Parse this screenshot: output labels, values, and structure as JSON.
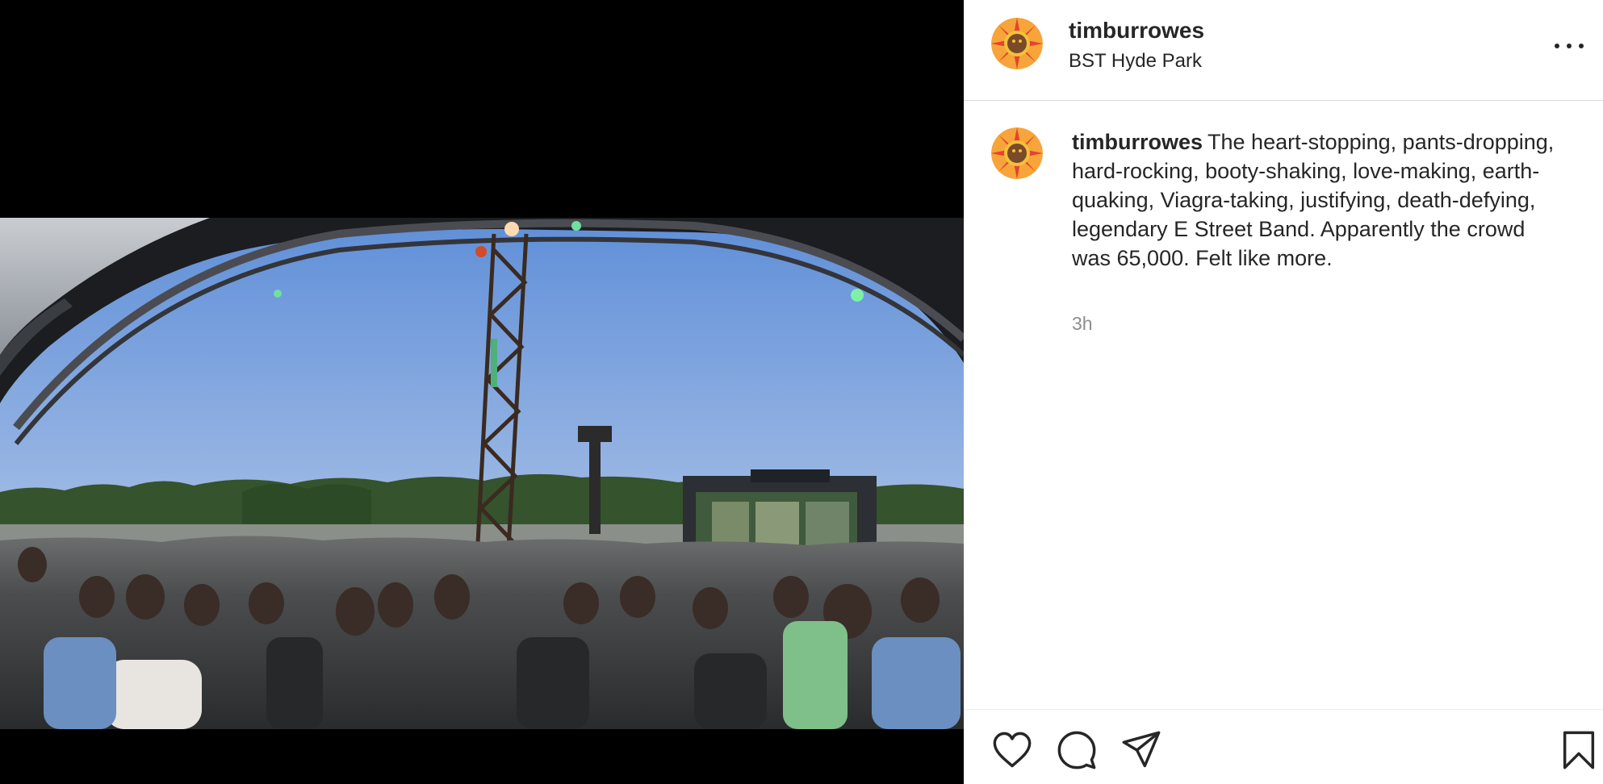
{
  "post": {
    "username": "timburrowes",
    "location": "BST Hyde Park",
    "caption_username": "timburrowes",
    "caption_text": "The heart-stopping, pants-dropping, hard-rocking, booty-shaking, love-making, earth-quaking, Viagra-taking, justifying, death-defying, legendary E Street Band. Apparently the crowd was 65,000. Felt like more.",
    "timestamp": "3h"
  },
  "icons": {
    "more": "more-options-icon",
    "like": "heart-icon",
    "comment": "comment-bubble-icon",
    "share": "paper-plane-icon",
    "save": "bookmark-icon"
  },
  "colors": {
    "text_primary": "#262626",
    "text_secondary": "#8e8e8e",
    "divider": "#dbdbdb",
    "media_background": "#000000"
  }
}
